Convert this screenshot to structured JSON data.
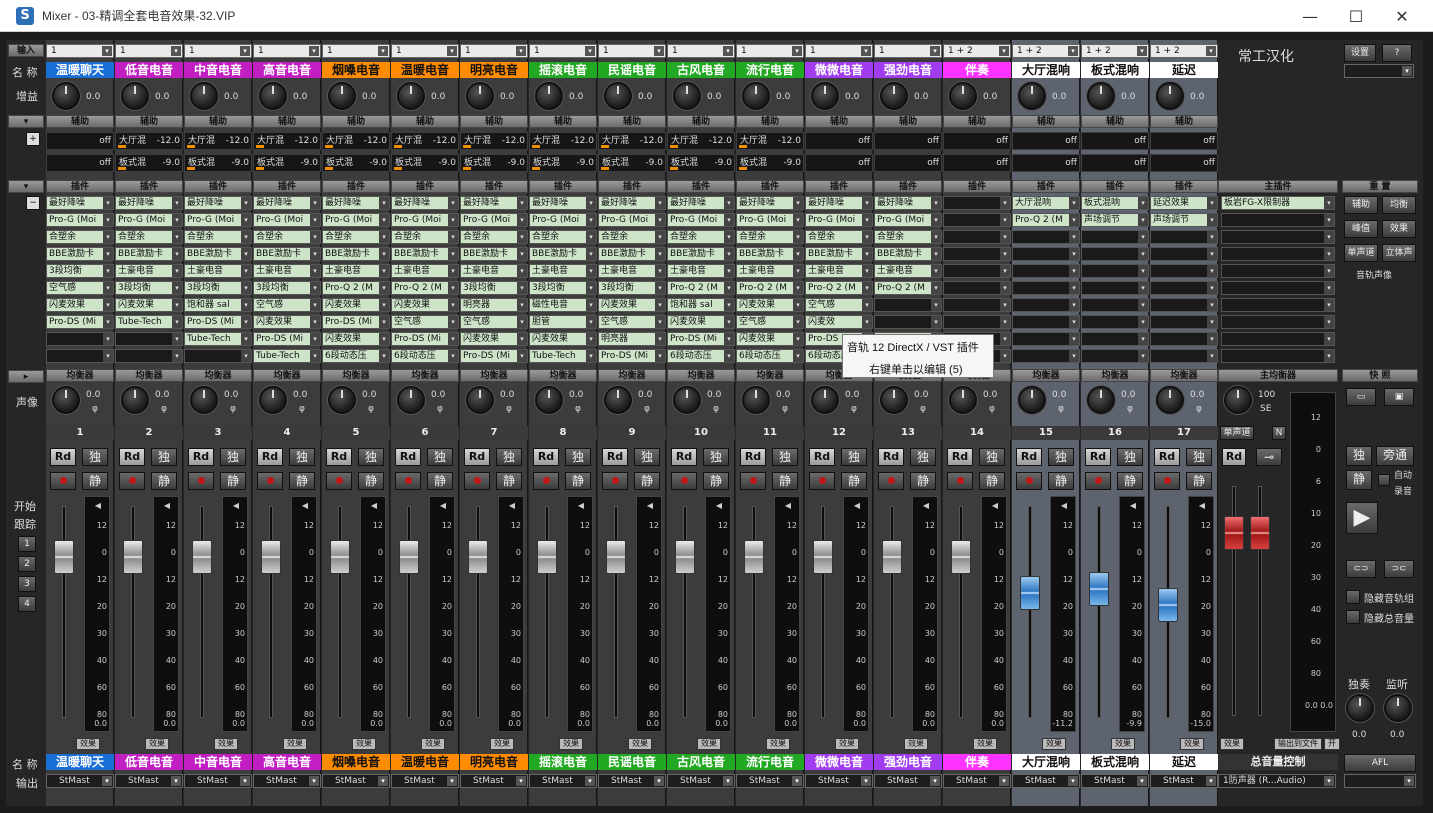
{
  "window": {
    "title": "Mixer - 03-精调全套电音效果-32.VIP",
    "icon": "S",
    "minimize": "—",
    "maximize": "☐",
    "close": "✕"
  },
  "left_labels": {
    "input": "输入",
    "name": "名 称",
    "gain": "增益",
    "aux": "辅助",
    "add": "+",
    "minus": "−",
    "pan": "声像",
    "start": "开始",
    "follow": "跟踪",
    "nums": [
      "1",
      "2",
      "3",
      "4"
    ],
    "name_bottom": "名 称",
    "output": "输出"
  },
  "headers": {
    "aux": "辅助",
    "plugins": "插件",
    "eq": "均衡器",
    "master_plugins": "主插件",
    "master_eq": "主均衡器",
    "snapshot": "快 照",
    "reset": "重 置"
  },
  "channels": [
    {
      "num": "1",
      "input": "1",
      "name": "温暖聊天",
      "name_bg": "#1a6fd6",
      "name_fg": "#ffffff",
      "gain": "0.0",
      "aux1": {
        "name": "",
        "val": "off"
      },
      "aux2": {
        "name": "",
        "val": "off"
      },
      "plugins": [
        "最好降噪",
        "Pro-G (Moi",
        "合塑余",
        "BBE激励卡",
        "3段均衡",
        "空气感",
        "闪麦效果",
        "Pro-DS (Mi",
        "",
        ""
      ],
      "pan": "0.0",
      "fader": "0.0",
      "meter_val": "",
      "style": "grey"
    },
    {
      "num": "2",
      "input": "1",
      "name": "低音电音",
      "name_bg": "#c21fc2",
      "name_fg": "#ffffff",
      "gain": "0.0",
      "aux1": {
        "name": "大厅混",
        "val": "-12.0"
      },
      "aux2": {
        "name": "板式混",
        "val": "-9.0"
      },
      "plugins": [
        "最好降噪",
        "Pro-G (Moi",
        "合塑余",
        "BBE激励卡",
        "土豪电音",
        "3段均衡",
        "闪麦效果",
        "Tube-Tech",
        "",
        ""
      ],
      "pan": "0.0",
      "fader": "0.0",
      "meter_val": "",
      "style": "grey"
    },
    {
      "num": "3",
      "input": "1",
      "name": "中音电音",
      "name_bg": "#c21fc2",
      "name_fg": "#ffffff",
      "gain": "0.0",
      "aux1": {
        "name": "大厅混",
        "val": "-12.0"
      },
      "aux2": {
        "name": "板式混",
        "val": "-9.0"
      },
      "plugins": [
        "最好降噪",
        "Pro-G (Moi",
        "合塑余",
        "BBE激励卡",
        "土豪电音",
        "3段均衡",
        "饱和器 sal",
        "Pro-DS (Mi",
        "Tube-Tech",
        ""
      ],
      "pan": "0.0",
      "fader": "0.0",
      "meter_val": "",
      "style": "grey"
    },
    {
      "num": "4",
      "input": "1",
      "name": "高音电音",
      "name_bg": "#c21fc2",
      "name_fg": "#ffffff",
      "gain": "0.0",
      "aux1": {
        "name": "大厅混",
        "val": "-12.0"
      },
      "aux2": {
        "name": "板式混",
        "val": "-9.0"
      },
      "plugins": [
        "最好降噪",
        "Pro-G (Moi",
        "合塑余",
        "BBE激励卡",
        "土豪电音",
        "3段均衡",
        "空气感",
        "闪麦效果",
        "Pro-DS (Mi",
        "Tube-Tech"
      ],
      "pan": "0.0",
      "fader": "0.0",
      "meter_val": "",
      "style": "grey"
    },
    {
      "num": "5",
      "input": "1",
      "name": "烟嗓电音",
      "name_bg": "#ff8c00",
      "name_fg": "#111111",
      "gain": "0.0",
      "aux1": {
        "name": "大厅混",
        "val": "-12.0"
      },
      "aux2": {
        "name": "板式混",
        "val": "-9.0"
      },
      "plugins": [
        "最好降噪",
        "Pro-G (Moi",
        "合塑余",
        "BBE激励卡",
        "土豪电音",
        "Pro-Q 2 (M",
        "闪麦效果",
        "Pro-DS (Mi",
        "闪麦效果",
        "6段动态压"
      ],
      "pan": "0.0",
      "fader": "0.0",
      "meter_val": "",
      "style": "grey"
    },
    {
      "num": "6",
      "input": "1",
      "name": "温暖电音",
      "name_bg": "#ff8c00",
      "name_fg": "#111111",
      "gain": "0.0",
      "aux1": {
        "name": "大厅混",
        "val": "-12.0"
      },
      "aux2": {
        "name": "板式混",
        "val": "-9.0"
      },
      "plugins": [
        "最好降噪",
        "Pro-G (Moi",
        "合塑余",
        "BBE激励卡",
        "土豪电音",
        "Pro-Q 2 (M",
        "闪麦效果",
        "空气感",
        "Pro-DS (Mi",
        "6段动态压"
      ],
      "pan": "0.0",
      "fader": "0.0",
      "meter_val": "",
      "style": "grey"
    },
    {
      "num": "7",
      "input": "1",
      "name": "明亮电音",
      "name_bg": "#ff8c00",
      "name_fg": "#111111",
      "gain": "0.0",
      "aux1": {
        "name": "大厅混",
        "val": "-12.0"
      },
      "aux2": {
        "name": "板式混",
        "val": "-9.0"
      },
      "plugins": [
        "最好降噪",
        "Pro-G (Moi",
        "合塑余",
        "BBE激励卡",
        "土豪电音",
        "3段均衡",
        "明亮器",
        "空气感",
        "闪麦效果",
        "Pro-DS (Mi"
      ],
      "pan": "0.0",
      "fader": "0.0",
      "meter_val": "",
      "style": "grey"
    },
    {
      "num": "8",
      "input": "1",
      "name": "摇滚电音",
      "name_bg": "#22a822",
      "name_fg": "#ffffff",
      "gain": "0.0",
      "aux1": {
        "name": "大厅混",
        "val": "-12.0"
      },
      "aux2": {
        "name": "板式混",
        "val": "-9.0"
      },
      "plugins": [
        "最好降噪",
        "Pro-G (Moi",
        "合塑余",
        "BBE激励卡",
        "土豪电音",
        "3段均衡",
        "磁性电音",
        "胆管",
        "闪麦效果",
        "Tube-Tech"
      ],
      "pan": "0.0",
      "fader": "0.0",
      "meter_val": "",
      "style": "grey"
    },
    {
      "num": "9",
      "input": "1",
      "name": "民谣电音",
      "name_bg": "#22a822",
      "name_fg": "#ffffff",
      "gain": "0.0",
      "aux1": {
        "name": "大厅混",
        "val": "-12.0"
      },
      "aux2": {
        "name": "板式混",
        "val": "-9.0"
      },
      "plugins": [
        "最好降噪",
        "Pro-G (Moi",
        "合塑余",
        "BBE激励卡",
        "土豪电音",
        "3段均衡",
        "闪麦效果",
        "空气感",
        "明亮器",
        "Pro-DS (Mi"
      ],
      "pan": "0.0",
      "fader": "0.0",
      "meter_val": "",
      "style": "grey"
    },
    {
      "num": "10",
      "input": "1",
      "name": "古风电音",
      "name_bg": "#22a822",
      "name_fg": "#ffffff",
      "gain": "0.0",
      "aux1": {
        "name": "大厅混",
        "val": "-12.0"
      },
      "aux2": {
        "name": "板式混",
        "val": "-9.0"
      },
      "plugins": [
        "最好降噪",
        "Pro-G (Moi",
        "合塑余",
        "BBE激励卡",
        "土豪电音",
        "Pro-Q 2 (M",
        "饱和器 sal",
        "闪麦效果",
        "Pro-DS (Mi",
        "6段动态压"
      ],
      "pan": "0.0",
      "fader": "0.0",
      "meter_val": "",
      "style": "grey"
    },
    {
      "num": "11",
      "input": "1",
      "name": "流行电音",
      "name_bg": "#22a822",
      "name_fg": "#ffffff",
      "gain": "0.0",
      "aux1": {
        "name": "大厅混",
        "val": "-12.0"
      },
      "aux2": {
        "name": "板式混",
        "val": "-9.0"
      },
      "plugins": [
        "最好降噪",
        "Pro-G (Moi",
        "合塑余",
        "BBE激励卡",
        "土豪电音",
        "Pro-Q 2 (M",
        "闪麦效果",
        "空气感",
        "闪麦效果",
        "6段动态压"
      ],
      "pan": "0.0",
      "fader": "0.0",
      "meter_val": "",
      "style": "grey"
    },
    {
      "num": "12",
      "input": "1",
      "name": "微微电音",
      "name_bg": "#a23cf0",
      "name_fg": "#ffffff",
      "gain": "0.0",
      "aux1": {
        "name": "",
        "val": "off"
      },
      "aux2": {
        "name": "",
        "val": "off"
      },
      "plugins": [
        "最好降噪",
        "Pro-G (Moi",
        "合塑余",
        "BBE激励卡",
        "土豪电音",
        "Pro-Q 2 (M",
        "空气感",
        "闪麦效",
        "Pro-DS (Mi",
        "6段动态压"
      ],
      "pan": "0.0",
      "fader": "0.0",
      "meter_val": "",
      "style": "grey"
    },
    {
      "num": "13",
      "input": "1",
      "name": "强劲电音",
      "name_bg": "#a23cf0",
      "name_fg": "#ffffff",
      "gain": "0.0",
      "aux1": {
        "name": "",
        "val": "off"
      },
      "aux2": {
        "name": "",
        "val": "off"
      },
      "plugins": [
        "最好降噪",
        "Pro-G (Moi",
        "合塑余",
        "BBE激励卡",
        "土豪电音",
        "Pro-Q 2 (M",
        "",
        "",
        "Pro-DS (Mi",
        ""
      ],
      "pan": "0.0",
      "fader": "0.0",
      "meter_val": "",
      "style": "grey"
    },
    {
      "num": "14",
      "input": "1 + 2",
      "name": "伴奏",
      "name_bg": "#ff33ff",
      "name_fg": "#ffffff",
      "gain": "0.0",
      "aux1": {
        "name": "",
        "val": "off"
      },
      "aux2": {
        "name": "",
        "val": "off"
      },
      "plugins": [
        "",
        "",
        "",
        "",
        "",
        "",
        "",
        "",
        "",
        ""
      ],
      "pan": "0.0",
      "fader": "0.0",
      "meter_val": "",
      "style": "grey"
    },
    {
      "num": "15",
      "input": "1 + 2",
      "name": "大厅混响",
      "name_bg": "#ffffff",
      "name_fg": "#111111",
      "gain": "0.0",
      "aux1": {
        "name": "",
        "val": "off"
      },
      "aux2": {
        "name": "",
        "val": "off"
      },
      "plugins": [
        "大厅混响",
        "Pro-Q 2 (M",
        "",
        "",
        "",
        "",
        "",
        "",
        "",
        ""
      ],
      "pan": "0.0",
      "fader": "-11.2",
      "meter_val": "-11.2",
      "style": "blue"
    },
    {
      "num": "16",
      "input": "1 + 2",
      "name": "板式混响",
      "name_bg": "#ffffff",
      "name_fg": "#111111",
      "gain": "0.0",
      "aux1": {
        "name": "",
        "val": "off"
      },
      "aux2": {
        "name": "",
        "val": "off"
      },
      "plugins": [
        "板式混响",
        "声场调节",
        "",
        "",
        "",
        "",
        "",
        "",
        "",
        ""
      ],
      "pan": "0.0",
      "fader": "-9.9",
      "meter_val": "-9.9",
      "style": "blue"
    },
    {
      "num": "17",
      "input": "1 + 2",
      "name": "延迟",
      "name_bg": "#ffffff",
      "name_fg": "#111111",
      "gain": "0.0",
      "aux1": {
        "name": "",
        "val": "off"
      },
      "aux2": {
        "name": "",
        "val": "off"
      },
      "plugins": [
        "延迟效果",
        "声场调节",
        "",
        "",
        "",
        "",
        "",
        "",
        "",
        ""
      ],
      "pan": "0.0",
      "fader": "-15.0",
      "meter_val": "-15.0",
      "style": "blue"
    }
  ],
  "strip_labels": {
    "rd": "Rd",
    "solo": "独",
    "mute": "静",
    "effects": "效果",
    "output": "StMast"
  },
  "meter_scale": [
    "12",
    "0",
    "12",
    "20",
    "30",
    "40",
    "60",
    "80",
    "0.0"
  ],
  "master": {
    "title": "常工汉化",
    "plugin": "板岩FG-X限制器",
    "pan": "100",
    "pan_mode": "SE",
    "mono": "单声道",
    "n_btn": "N",
    "rd": "Rd",
    "name": "总音量控制",
    "output": "1防声器 (R...Audio)",
    "effects": "效果",
    "export": "输出到文件",
    "on": "开",
    "scale": [
      "12",
      "0",
      "6",
      "10",
      "20",
      "30",
      "40",
      "60",
      "80",
      "0.0 0.0"
    ]
  },
  "right_panel": {
    "settings": "设置",
    "help": "?",
    "aux_btn": "辅助",
    "eq_btn": "均衡",
    "peak_btn": "峰值",
    "fx_btn": "效果",
    "mono_btn": "单声道",
    "stereo_btn": "立体声",
    "track_pan": "音轨声像",
    "solo": "独",
    "bypass": "旁通",
    "mute": "静",
    "auto": "自动",
    "record": "录音",
    "hide_groups": "隐藏音轨组",
    "hide_master": "隐藏总音量",
    "solo_lbl": "独奏",
    "monitor_lbl": "监听",
    "solo_val": "0.0",
    "monitor_val": "0.0",
    "afl": "AFL"
  },
  "tooltip": {
    "line1": "音轨 12 DirectX / VST 插件",
    "line2": "右键单击以编辑 (5)"
  }
}
